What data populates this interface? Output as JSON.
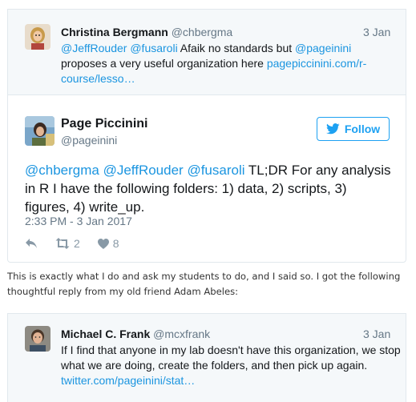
{
  "reply_tweet": {
    "name": "Christina Bergmann",
    "handle": "@chbergma",
    "date": "3 Jan",
    "mention1": "@JeffRouder",
    "mention2": "@fusaroli",
    "text1": " Afaik no standards but ",
    "mention3": "@pageinini",
    "text2": " proposes a very useful organization here ",
    "link": "pagepiccinini.com/r-course/lesso…"
  },
  "main_tweet": {
    "name": "Page Piccinini",
    "handle": "@pageinini",
    "follow_label": "Follow",
    "mention1": "@chbergma",
    "mention2": "@JeffRouder",
    "mention3": "@fusaroli",
    "text": " TL;DR For any analysis in R I have the following folders: 1) data, 2) scripts, 3) figures, 4) write_up.",
    "timestamp": "2:33 PM - 3 Jan 2017",
    "retweets": "2",
    "likes": "8"
  },
  "paragraph": "This is exactly what I do and ask my students to do, and I said so. I got the following thoughtful reply from my old friend Adam Abeles:",
  "second_tweet": {
    "name": "Michael C. Frank",
    "handle": "@mcxfrank",
    "date": "3 Jan",
    "text": "If I find that anyone in my lab doesn't have this organization, we stop what we are doing, create the folders, and then pick up again. ",
    "link": "twitter.com/pageinini/stat…"
  },
  "colors": {
    "link": "#1b95e0",
    "follow": "#1da1f2",
    "muted": "#657786",
    "card_bg": "#f5f8fa"
  },
  "icons": [
    "reply-icon",
    "retweet-icon",
    "heart-icon",
    "twitter-bird-icon"
  ]
}
